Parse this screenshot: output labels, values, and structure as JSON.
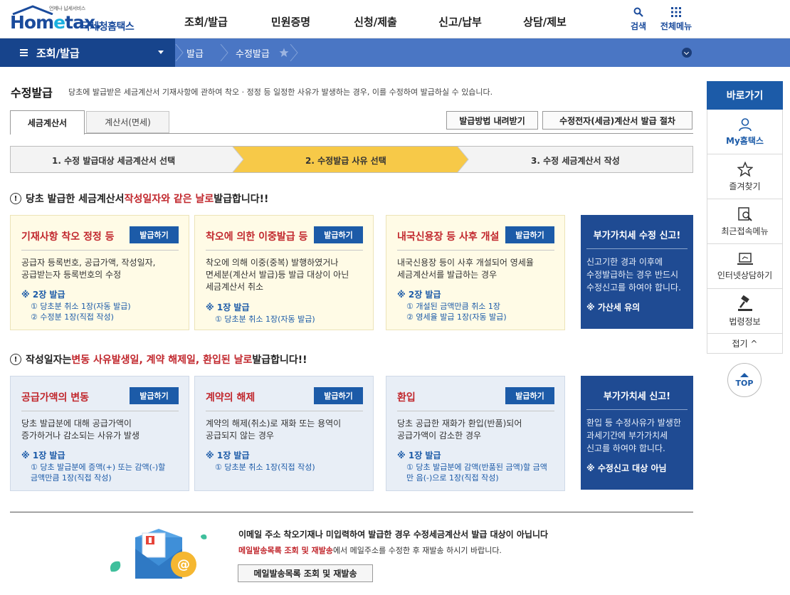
{
  "header": {
    "logo_small": "언제나 납세서비스",
    "logo_main_a": "Hom",
    "logo_main_b": "e",
    "logo_main_c": "tax.",
    "logo_kr": "국세청홈택스",
    "gnb": [
      "조회/발급",
      "민원증명",
      "신청/제출",
      "신고/납부",
      "상담/제보"
    ],
    "search_label": "검색",
    "allmenu_label": "전체메뉴"
  },
  "navbar": {
    "menu": "조회/발급",
    "crumb1": "발급",
    "crumb2": "수정발급"
  },
  "page": {
    "title": "수정발급",
    "desc": "당초에 발급받은 세금계산서 기재사항에 관하여 착오 · 정정 등 일정한 사유가 발생하는 경우, 이를 수정하여 발급하실 수 있습니다."
  },
  "tabs": {
    "tab1": "세금계산서",
    "tab2": "계산서(면세)",
    "btn1": "발급방법 내려받기",
    "btn2": "수정전자(세금)계산서 발급 절차"
  },
  "steps": {
    "s1": "1. 수정 발급대상 세금계산서 선택",
    "s2": "2. 수정발급 사유 선택",
    "s3": "3. 수정 세금계산서 작성"
  },
  "section1": {
    "h_a": "당초 발급한 세금계산서 ",
    "h_b": "작성일자와 같은 날로",
    "h_c": " 발급합니다!!",
    "cards": [
      {
        "title": "기재사항 착오 정정 등",
        "btn": "발급하기",
        "desc1": "공급자 등록번호, 공급가액, 작성일자,",
        "desc2": "공급받는자 등록번호의 수정",
        "desc3": "",
        "count": "※ 2장 발급",
        "sub1": "① 당초분 취소 1장(자동 발급)",
        "sub2": "② 수정분 1장(직접 작성)"
      },
      {
        "title": "착오에 의한 이중발급 등",
        "btn": "발급하기",
        "desc1": "착오에 의해 이중(중복) 발행하였거나",
        "desc2": "면세분(계산서 발급)등 발급 대상이 아닌",
        "desc3": "세금계산서 취소",
        "count": "※ 1장 발급",
        "sub1": "① 당초분 취소 1장(자동 발급)",
        "sub2": ""
      },
      {
        "title": "내국신용장 등 사후 개설",
        "btn": "발급하기",
        "desc1": "내국신용장 등이 사후 개설되어 영세율",
        "desc2": "세금계산서를 발급하는 경우",
        "desc3": "",
        "count": "※ 2장 발급",
        "sub1": "① 개설된 금액만큼 취소 1장",
        "sub2": "② 영세율 발급 1장(자동 발급)"
      }
    ],
    "side": {
      "title": "부가가치세 수정 신고!",
      "desc1": "신고기한 경과 이후에",
      "desc2": "수정발급하는 경우 반드시",
      "desc3": "수정신고를 하여야 합니다.",
      "note": "※ 가산세 유의"
    }
  },
  "section2": {
    "h_a": "작성일자는 ",
    "h_b": "변동 사유발생일, 계약 해제일, 환입된 날로",
    "h_c": " 발급합니다!!",
    "cards": [
      {
        "title": "공급가액의 변동",
        "btn": "발급하기",
        "desc1": "당초 발급분에 대해 공급가액이",
        "desc2": "증가하거나 감소되는 사유가 발생",
        "count": "※ 1장 발급",
        "sub1": "① 당초 발급분에 증액(+) 또는 감액(-)할",
        "sub2": "금액만큼 1장(직접 작성)"
      },
      {
        "title": "계약의 해제",
        "btn": "발급하기",
        "desc1": "계약의 해제(취소)로 재화 또는 용역이",
        "desc2": "공급되지 않는 경우",
        "count": "※ 1장 발급",
        "sub1": "① 당초분 취소 1장(직접 작성)",
        "sub2": ""
      },
      {
        "title": "환입",
        "btn": "발급하기",
        "desc1": "당초 공급한 재화가 환입(반품)되어",
        "desc2": "공급가액이 감소한 경우",
        "count": "※ 1장 발급",
        "sub1": "① 당초 발급분에 감액(반품된 금액)할 금액",
        "sub2": "만 음(-)으로 1장(직접 작성)"
      }
    ],
    "side": {
      "title": "부가가치세 신고!",
      "desc1": "환입 등 수정사유가 발생한",
      "desc2": "과세기간에 부가가치세",
      "desc3": "신고를 하여야 합니다.",
      "note": "※ 수정신고 대상 아님"
    }
  },
  "bottom": {
    "notice1": "이메일 주소 착오기재나 미입력하여 발급한 경우 수정세금계산서 발급 대상이 아닙니다",
    "notice2_red": "메일발송목록 조회 및 재발송",
    "notice2_rest": "에서 메일주소를 수정한 후 재발송 하시기 바랍니다.",
    "button": "메일발송목록 조회 및 재발송"
  },
  "quick": {
    "head": "바로가기",
    "items": [
      "My홈택스",
      "즐겨찾기",
      "최근접속메뉴",
      "인터넷상담하기",
      "법령정보"
    ],
    "close": "접기 ^",
    "top": "TOP"
  },
  "colors": {
    "brand_dark": "#17448c",
    "brand_blue": "#1c5ba8",
    "nav_blue": "#4a76c4",
    "accent_red": "#c1272d",
    "step_active": "#f7c948",
    "card_yellow": "#fffbe6",
    "card_blue": "#e8eef6"
  }
}
